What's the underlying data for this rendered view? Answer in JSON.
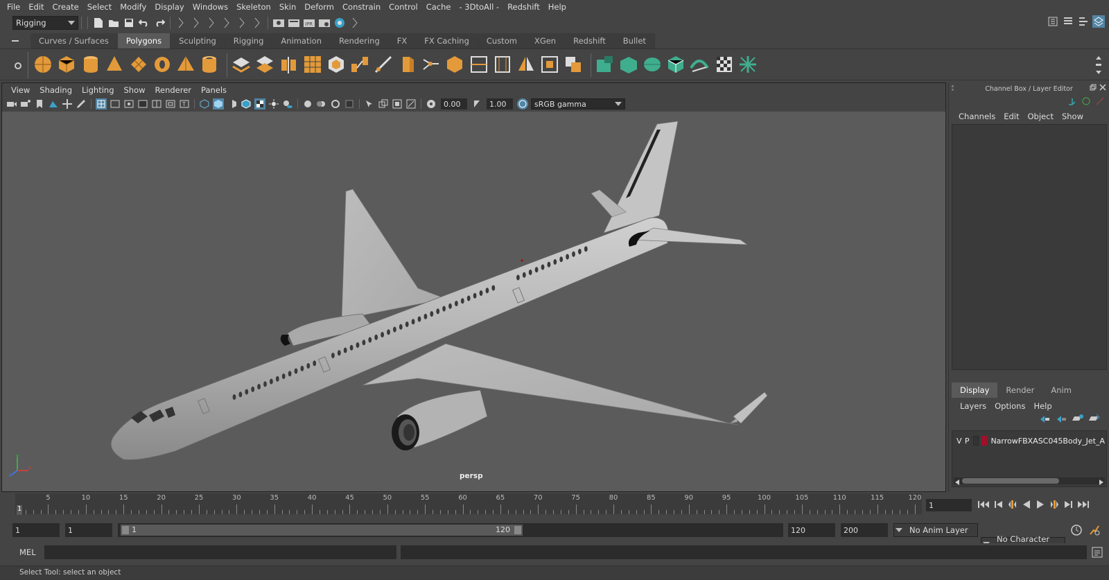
{
  "menubar": [
    "File",
    "Edit",
    "Create",
    "Select",
    "Modify",
    "Display",
    "Windows",
    "Skeleton",
    "Skin",
    "Deform",
    "Constrain",
    "Control",
    "Cache",
    "- 3DtoAll -",
    "Redshift",
    "Help"
  ],
  "status": {
    "mode": "Rigging"
  },
  "shelf_tabs": [
    "Curves / Surfaces",
    "Polygons",
    "Sculpting",
    "Rigging",
    "Animation",
    "Rendering",
    "FX",
    "FX Caching",
    "Custom",
    "XGen",
    "Redshift",
    "Bullet"
  ],
  "shelf_active": "Polygons",
  "viewport": {
    "menu": [
      "View",
      "Shading",
      "Lighting",
      "Show",
      "Renderer",
      "Panels"
    ],
    "exposure": "0.00",
    "gamma": "1.00",
    "colorspace": "sRGB gamma",
    "camera": "persp"
  },
  "channel_box": {
    "title": "Channel Box / Layer Editor",
    "menu": [
      "Channels",
      "Edit",
      "Object",
      "Show"
    ]
  },
  "layer_editor": {
    "tabs": [
      "Display",
      "Render",
      "Anim"
    ],
    "active_tab": "Display",
    "menu": [
      "Layers",
      "Options",
      "Help"
    ],
    "layers": [
      {
        "v": "V",
        "p": "P",
        "color": "#a0102a",
        "name": "NarrowFBXASC045Body_Jet_A"
      }
    ]
  },
  "timeline": {
    "labels": [
      "5",
      "10",
      "15",
      "20",
      "25",
      "30",
      "35",
      "40",
      "45",
      "50",
      "55",
      "60",
      "65",
      "70",
      "75",
      "80",
      "85",
      "90",
      "95",
      "100",
      "105",
      "110",
      "115",
      "120"
    ],
    "current_frame": "1",
    "frame_field": "1"
  },
  "range": {
    "start": "1",
    "playback_start": "1",
    "slider_start": "1",
    "slider_end": "120",
    "playback_end": "120",
    "end": "200",
    "anim_layer": "No Anim Layer",
    "character_set": "No Character Set"
  },
  "command": {
    "label": "MEL"
  },
  "help": {
    "text": "Select Tool: select an object"
  },
  "colors": {
    "bg": "#444444",
    "viewport": "#5b5b5b",
    "accent": "#5285a6",
    "shelf_orange": "#e39a3a",
    "shelf_teal": "#3fae8e"
  }
}
